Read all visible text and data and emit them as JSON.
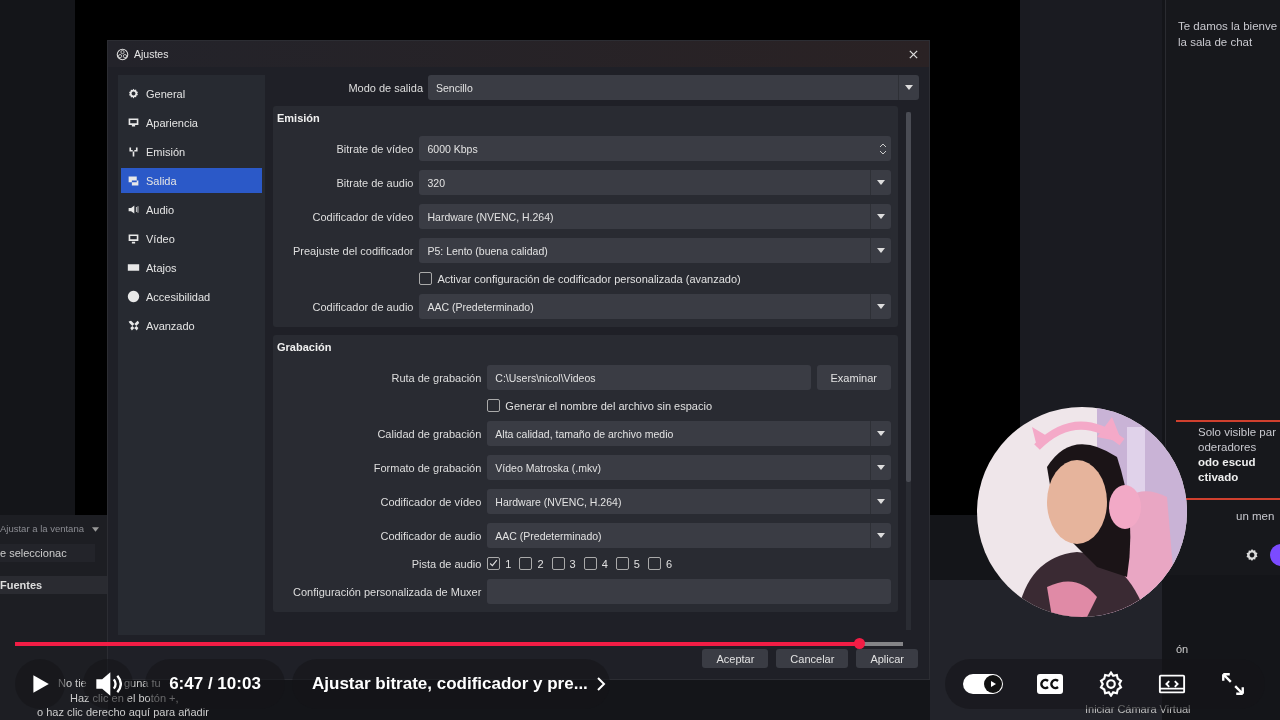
{
  "obs_background": {
    "zoom_dropdown": "Ajustar a la ventana",
    "scene_hint": "e seleccionac",
    "sources_header": "Fuentes",
    "empty_lines": [
      "No tie",
      "guna fu",
      "Haz clic en el botón +,",
      "o haz clic derecho aquí para añadir"
    ],
    "chat": {
      "welcome": [
        "Te damos la bienve",
        "la sala de chat"
      ],
      "notice": [
        "Solo visible par",
        "oderadores"
      ],
      "shield": [
        "odo escud",
        "ctivado"
      ],
      "input_placeholder": "un men"
    },
    "controls_fragment": "ón",
    "virtual_camera": "Iniciar Cámara Virtual"
  },
  "dialog": {
    "title": "Ajustes",
    "sidebar": [
      {
        "label": "General",
        "selected": false
      },
      {
        "label": "Apariencia",
        "selected": false
      },
      {
        "label": "Emisión",
        "selected": false
      },
      {
        "label": "Salida",
        "selected": true
      },
      {
        "label": "Audio",
        "selected": false
      },
      {
        "label": "Vídeo",
        "selected": false
      },
      {
        "label": "Atajos",
        "selected": false
      },
      {
        "label": "Accesibilidad",
        "selected": false
      },
      {
        "label": "Avanzado",
        "selected": false
      }
    ],
    "output_mode": {
      "label": "Modo de salida",
      "value": "Sencillo"
    },
    "sections": [
      {
        "title": "Emisión",
        "rows": [
          {
            "kind": "spin",
            "label": "Bitrate de vídeo",
            "value": "6000 Kbps"
          },
          {
            "kind": "select",
            "label": "Bitrate de audio",
            "value": "320"
          },
          {
            "kind": "select",
            "label": "Codificador de vídeo",
            "value": "Hardware (NVENC, H.264)"
          },
          {
            "kind": "select",
            "label": "Preajuste del codificador",
            "value": "P5: Lento (buena calidad)"
          },
          {
            "kind": "check",
            "label": "Activar configuración de codificador personalizada (avanzado)",
            "checked": false
          },
          {
            "kind": "select",
            "label": "Codificador de audio",
            "value": "AAC (Predeterminado)"
          }
        ]
      },
      {
        "title": "Grabación",
        "rows": [
          {
            "kind": "path",
            "label": "Ruta de grabación",
            "value": "C:\\Users\\nicol\\Videos",
            "button": "Examinar"
          },
          {
            "kind": "check",
            "label": "Generar el nombre del archivo sin espacio",
            "checked": false
          },
          {
            "kind": "select",
            "label": "Calidad de grabación",
            "value": "Alta calidad, tamaño de archivo medio"
          },
          {
            "kind": "select",
            "label": "Formato de grabación",
            "value": "Vídeo Matroska (.mkv)"
          },
          {
            "kind": "select",
            "label": "Codificador de vídeo",
            "value": "Hardware (NVENC, H.264)"
          },
          {
            "kind": "select",
            "label": "Codificador de audio",
            "value": "AAC (Predeterminado)"
          },
          {
            "kind": "tracks",
            "label": "Pista de audio",
            "tracks": [
              {
                "label": "1",
                "checked": true
              },
              {
                "label": "2",
                "checked": false
              },
              {
                "label": "3",
                "checked": false
              },
              {
                "label": "4",
                "checked": false
              },
              {
                "label": "5",
                "checked": false
              },
              {
                "label": "6",
                "checked": false
              }
            ]
          },
          {
            "kind": "text",
            "label": "Configuración personalizada de Muxer"
          }
        ]
      }
    ],
    "buttons": [
      "Aceptar",
      "Cancelar",
      "Aplicar"
    ]
  },
  "player": {
    "progress": {
      "level": 0.675
    },
    "time": "6:47 / 10:03",
    "chapter": "Ajustar bitrate, codificador y pre...",
    "autoplay": {
      "on": true
    }
  }
}
